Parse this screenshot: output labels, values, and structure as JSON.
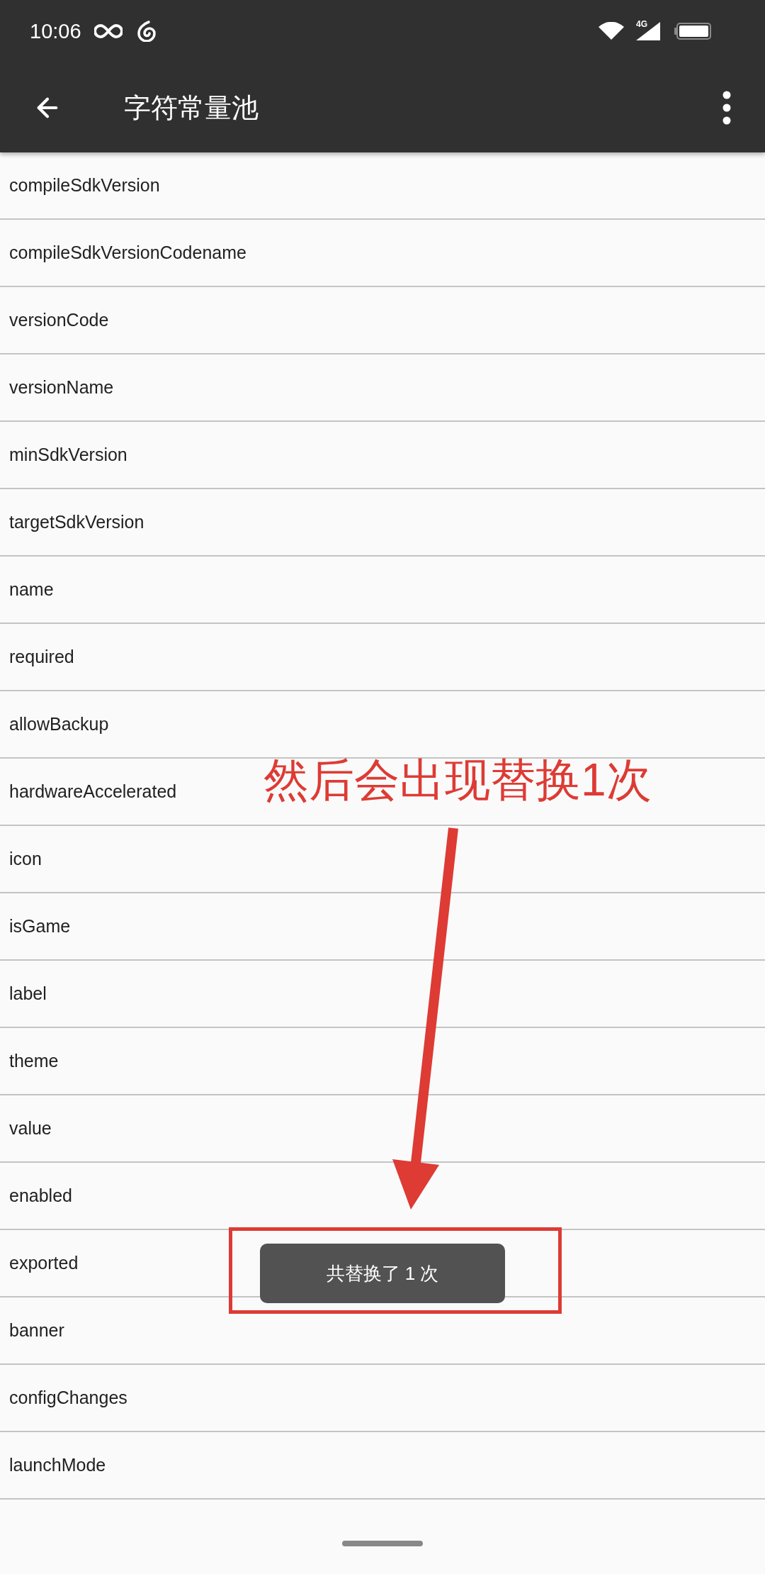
{
  "status_bar": {
    "time": "10:06",
    "network": "4G"
  },
  "toolbar": {
    "title": "字符常量池"
  },
  "rows": [
    "compileSdkVersion",
    "compileSdkVersionCodename",
    "versionCode",
    "versionName",
    "minSdkVersion",
    "targetSdkVersion",
    "name",
    "required",
    "allowBackup",
    "hardwareAccelerated",
    "icon",
    "isGame",
    "label",
    "theme",
    "value",
    "enabled",
    "exported",
    "banner",
    "configChanges",
    "launchMode"
  ],
  "toast": {
    "text": "共替换了 1 次"
  },
  "annotation": {
    "text": "然后会出现替换1次"
  }
}
